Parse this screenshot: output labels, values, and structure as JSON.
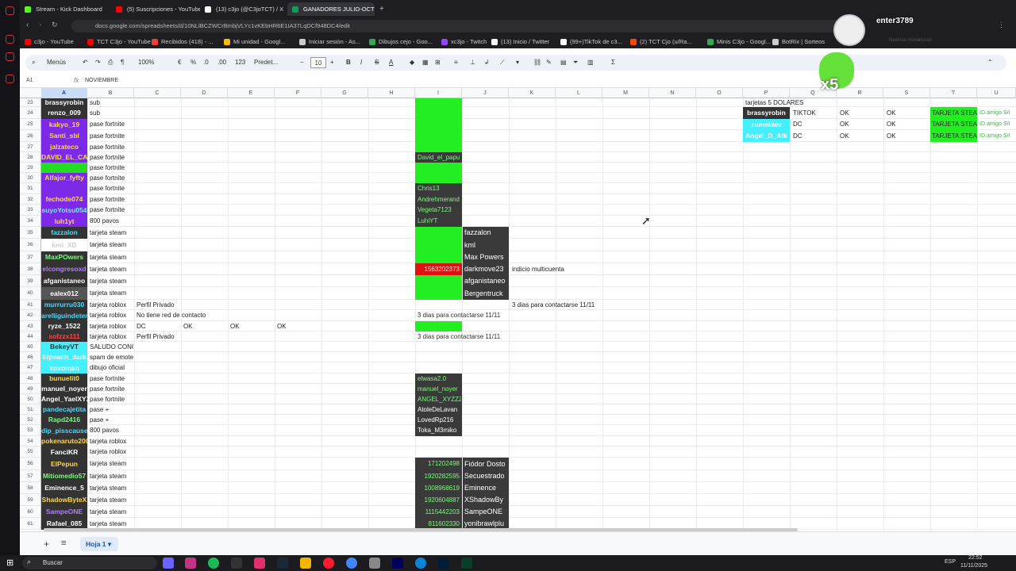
{
  "browser": {
    "tabs": [
      {
        "label": "Stream - Kick Dashboard",
        "color": "#53fc18"
      },
      {
        "label": "(5) Suscripciones - YouTube",
        "color": "#ff0000"
      },
      {
        "label": "(13) c3jo (@C3joTCT) / X",
        "color": "#ffffff"
      },
      {
        "label": "GANADORES JULIO-OCT",
        "color": "#0f9d58"
      }
    ],
    "url": "docs.google.com/spreadsheets/d/10NLlBCZWCrBmbjVLYc1vKEbHR6E1IA37LqDCf948DC4/edit",
    "bookmarks": [
      {
        "label": "c3jo - YouTube",
        "color": "#ff0000"
      },
      {
        "label": "TCT C3jo - YouTube",
        "color": "#ff0000"
      },
      {
        "label": "Recibidos (418) - ...",
        "color": "#ea4335"
      },
      {
        "label": "Mi unidad - Googl...",
        "color": "#fbbc04"
      },
      {
        "label": "Iniciar sesión - As...",
        "color": "#cccccc"
      },
      {
        "label": "Dibujos cejo - Goo...",
        "color": "#34a853"
      },
      {
        "label": "xc3jo - Twitch",
        "color": "#9146ff"
      },
      {
        "label": "(13) Inicio / Twitter",
        "color": "#ffffff"
      },
      {
        "label": "(99+)TikTok de c3...",
        "color": "#ffffff"
      },
      {
        "label": "(2) TCT Cjo (u/Ra...",
        "color": "#ff4500"
      },
      {
        "label": "Minis C3jo - Googl...",
        "color": "#34a853"
      },
      {
        "label": "BotRix | Sorteos",
        "color": "#cccccc"
      }
    ]
  },
  "toolbar": {
    "menus": "Menús",
    "zoom": "100%",
    "currency": "€",
    "percent": "%",
    "dec_less": ".0",
    "dec_more": ".00",
    "format_123": "123",
    "font": "Predet...",
    "font_size": "10"
  },
  "formula": {
    "namebox": "A1",
    "fx": "fx",
    "content": "NOVIEMBRE"
  },
  "columns": [
    "A",
    "B",
    "C",
    "D",
    "E",
    "F",
    "G",
    "H",
    "I",
    "J",
    "K",
    "L",
    "M",
    "N",
    "O",
    "P",
    "Q",
    "R",
    "S",
    "T",
    "U"
  ],
  "rows": [
    "23",
    "24",
    "25",
    "26",
    "27",
    "28",
    "29",
    "30",
    "31",
    "32",
    "33",
    "34",
    "35",
    "36",
    "37",
    "38",
    "39",
    "40",
    "41",
    "42",
    "43",
    "44",
    "45",
    "46",
    "47",
    "48",
    "49",
    "50",
    "51",
    "52",
    "53",
    "54",
    "55",
    "56",
    "57",
    "58",
    "59",
    "60",
    "61"
  ],
  "col_a": [
    {
      "t": "brassyrobin",
      "bg": "#333333",
      "fg": "#ffffff"
    },
    {
      "t": "renzo_009",
      "bg": "#333333",
      "fg": "#ffffff"
    },
    {
      "t": "kakyo_19",
      "bg": "#7d2ae8",
      "fg": "#ffd84a"
    },
    {
      "t": "Santi_sbl",
      "bg": "#7d2ae8",
      "fg": "#ffd84a"
    },
    {
      "t": "jalzateco",
      "bg": "#7d2ae8",
      "fg": "#ffd84a"
    },
    {
      "t": "DAVID_EL_CAC",
      "bg": "#7d2ae8",
      "fg": "#ffd84a"
    },
    {
      "t": "",
      "bg": "#22dd22",
      "fg": "#ffffff"
    },
    {
      "t": "Alfajor_fyfty",
      "bg": "#7d2ae8",
      "fg": "#ffd84a"
    },
    {
      "t": "",
      "bg": "#7d2ae8",
      "fg": "#ffffff"
    },
    {
      "t": "fechode074",
      "bg": "#7d2ae8",
      "fg": "#ffd84a"
    },
    {
      "t": "suyoYotsu054",
      "bg": "#7d2ae8",
      "fg": "#6ff0ff"
    },
    {
      "t": "luh1yt",
      "bg": "#7d2ae8",
      "fg": "#ffd84a"
    },
    {
      "t": "fazzalon",
      "bg": "#333333",
      "fg": "#4ad9ff"
    },
    {
      "t": "kml_XD",
      "bg": "#ffffff",
      "fg": "#cccccc"
    },
    {
      "t": "MaxPOwers",
      "bg": "#333333",
      "fg": "#7cfa7c"
    },
    {
      "t": "elcongresoxd",
      "bg": "#333333",
      "fg": "#b57bff"
    },
    {
      "t": "afganistaneo",
      "bg": "#333333",
      "fg": "#ffffff"
    },
    {
      "t": "ealex012",
      "bg": "#555555",
      "fg": "#ffffff"
    },
    {
      "t": "murrurru030",
      "bg": "#333333",
      "fg": "#4ad9ff"
    },
    {
      "t": "arelliguindeten",
      "bg": "#333333",
      "fg": "#4ad9ff"
    },
    {
      "t": "ryze_1522",
      "bg": "#333333",
      "fg": "#ffffff"
    },
    {
      "t": "sofzzx111",
      "bg": "#333333",
      "fg": "#ff4444"
    },
    {
      "t": "BekeyVT",
      "bg": "#44f0ff",
      "fg": "#333333"
    },
    {
      "t": "Elpeach_dark",
      "bg": "#44f0ff",
      "fg": "#ffffff"
    },
    {
      "t": "xoxoman",
      "bg": "#44f0ff",
      "fg": "#ffffff"
    },
    {
      "t": "bunuelit0",
      "bg": "#333333",
      "fg": "#ffd84a"
    },
    {
      "t": "manuel_noyer",
      "bg": "#333333",
      "fg": "#ffffff"
    },
    {
      "t": "Angel_YaelXYZ",
      "bg": "#333333",
      "fg": "#ffffff"
    },
    {
      "t": "pandecajetita",
      "bg": "#333333",
      "fg": "#4ad9ff"
    },
    {
      "t": "Rapd2416",
      "bg": "#333333",
      "fg": "#7cfa7c"
    },
    {
      "t": "dip_pisscause",
      "bg": "#333333",
      "fg": "#4ad9ff"
    },
    {
      "t": "pokenaruto200",
      "bg": "#333333",
      "fg": "#ffd84a"
    },
    {
      "t": "FanciKR",
      "bg": "#333333",
      "fg": "#ffffff"
    },
    {
      "t": "ElPepun",
      "bg": "#333333",
      "fg": "#ffd84a"
    },
    {
      "t": "Mitiomedio57",
      "bg": "#333333",
      "fg": "#7cfa7c"
    },
    {
      "t": "Eminence_5",
      "bg": "#333333",
      "fg": "#ffffff"
    },
    {
      "t": "ShadowByteX",
      "bg": "#333333",
      "fg": "#ffd84a"
    },
    {
      "t": "SampeONE",
      "bg": "#333333",
      "fg": "#b57bff"
    },
    {
      "t": "Rafael_085",
      "bg": "#333333",
      "fg": "#ffffff"
    }
  ],
  "col_b": [
    "sub",
    "sub",
    "pase fortnite",
    "pase fortnite",
    "pase fortnite",
    "pase fortnite",
    "pase fortnite",
    "pase fortnite",
    "pase fortnite",
    "pase fortnite",
    "pase fortnite",
    "800 pavos",
    "tarjeta steam",
    "tarjeta steam",
    "tarjeta steam",
    "tarjeta steam",
    "tarjeta steam",
    "tarjeta steam",
    "tarjeta roblox",
    "tarjeta roblox",
    "tarjeta roblox",
    "tarjeta roblox",
    "SALUDO CONCAM",
    "spam de emotes",
    "dibujo oficial",
    "pase fortnite",
    "pase fortnite",
    "pase fortnite",
    "pase +",
    "pase +",
    "800 pavos",
    "tarjeta roblox",
    "tarjeta roblox",
    "tarjeta steam",
    "tarjeta steam",
    "tarjeta steam",
    "tarjeta steam",
    "tarjeta steam",
    "tarjeta steam"
  ],
  "col_c": {
    "18": "Perfil Privado",
    "19": "No tiene red de contacto",
    "20": "DC",
    "21": "Perfil Privado"
  },
  "row43_ok": [
    "OK",
    "OK",
    "OK"
  ],
  "col_i": {
    "5": "David_el_papu",
    "8": "Chris13",
    "9": "Andrehmerand",
    "10": "Vegeta7123",
    "11": "LuhiYT",
    "15": "1563202373",
    "19": "3 dias para contactarse 11/11",
    "21": "3 dias para contactarse 11/11",
    "25": "elwasa2.0",
    "26": "manuel_noyer",
    "27": "ANGEL_XYZZZ",
    "28": "AtoleDeLavan",
    "29": "LovedRp216",
    "30": "Toka_M3miko",
    "33": "171202498",
    "34": "1920282595",
    "35": "1008968619",
    "36": "1920604887",
    "37": "1115442203",
    "38": "811602330"
  },
  "col_j": {
    "12": "fazzalon",
    "13": "kml",
    "14": "Max Powers",
    "15": "darkmove23",
    "16": "afganistaneo",
    "17": "Bergentruck",
    "33": "Fiódor Dosto",
    "34": "Secuestrado",
    "35": "Eminence",
    "36": "XShadowBy",
    "37": "SampeONE",
    "38": "yonibrawlplu"
  },
  "col_k": {
    "15": "indicio multicuenta",
    "18": "3 dias para contactarse 11/11"
  },
  "right_block": {
    "title": "tarjetas 5 DOLARES",
    "rows": [
      {
        "p": "brassyrobin",
        "q": "TIKTOK",
        "r": "OK",
        "s": "OK",
        "t": "TARJETA STEAM",
        "u": "ID amigo S/I"
      },
      {
        "p": "zumeldev",
        "q": "DC",
        "r": "OK",
        "s": "OK",
        "t": "TARJETA STEAM",
        "u": "ID amigo S/I"
      },
      {
        "p": "Angel_D_Afk",
        "q": "DC",
        "r": "OK",
        "s": "OK",
        "t": "TARJETA STEAM",
        "u": "ID amigo S/I"
      }
    ]
  },
  "sheet_tabs": {
    "add": "+",
    "active": "Hoja 1"
  },
  "overlay": {
    "user": "enter3789",
    "multiplier": "x5",
    "muted_text": "Nuevas miniaturas"
  },
  "taskbar": {
    "search": "Buscar",
    "lang": "ESP",
    "time": "22:52",
    "date": "11/11/2025"
  }
}
